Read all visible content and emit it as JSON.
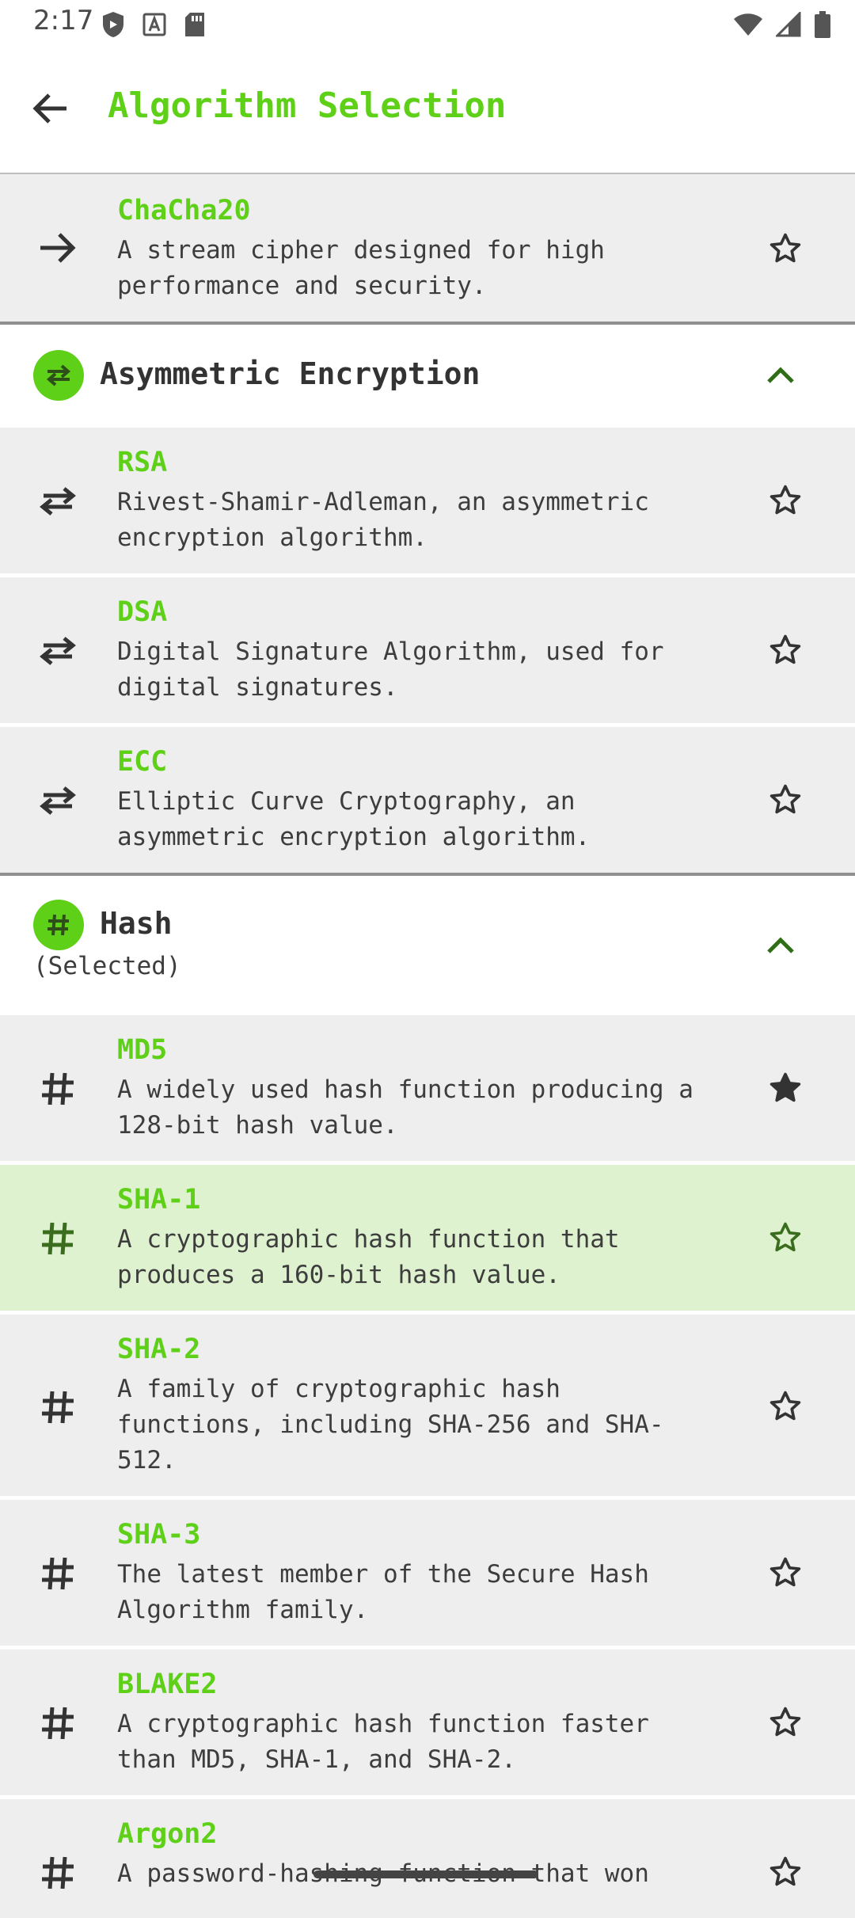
{
  "status_bar": {
    "time": "2:17"
  },
  "app_bar": {
    "title": "Algorithm Selection"
  },
  "colors": {
    "accent": "#5fd018",
    "selected_row": "#dff2cf",
    "row_bg": "#eeeeee"
  },
  "symmetric_tail": {
    "items": [
      {
        "title": "ChaCha20",
        "desc": "A stream cipher designed for high performance and security.",
        "icon": "arrow-right-icon",
        "favorite": false
      }
    ]
  },
  "asymmetric": {
    "title": "Asymmetric Encryption",
    "icon": "swap-icon",
    "items": [
      {
        "title": "RSA",
        "desc": "Rivest-Shamir-Adleman, an asymmetric encryption algorithm.",
        "icon": "swap-icon",
        "favorite": false
      },
      {
        "title": "DSA",
        "desc": "Digital Signature Algorithm, used for digital signatures.",
        "icon": "swap-icon",
        "favorite": false
      },
      {
        "title": "ECC",
        "desc": "Elliptic Curve Cryptography, an asymmetric encryption algorithm.",
        "icon": "swap-icon",
        "favorite": false
      }
    ]
  },
  "hash": {
    "title": "Hash",
    "subtitle": "(Selected)",
    "icon": "hash-icon",
    "items": [
      {
        "title": "MD5",
        "desc": "A widely used hash function producing a 128-bit hash value.",
        "icon": "hash-icon",
        "favorite": true
      },
      {
        "title": "SHA-1",
        "desc": "A cryptographic hash function that produces a 160-bit hash value.",
        "icon": "hash-icon",
        "favorite": false,
        "selected": true
      },
      {
        "title": "SHA-2",
        "desc": "A family of cryptographic hash functions, including SHA-256 and SHA-512.",
        "icon": "hash-icon",
        "favorite": false
      },
      {
        "title": "SHA-3",
        "desc": "The latest member of the Secure Hash Algorithm family.",
        "icon": "hash-icon",
        "favorite": false
      },
      {
        "title": "BLAKE2",
        "desc": "A cryptographic hash function faster than MD5, SHA-1, and SHA-2.",
        "icon": "hash-icon",
        "favorite": false
      },
      {
        "title": "Argon2",
        "desc": "A password-hashing function that won",
        "icon": "hash-icon",
        "favorite": false
      }
    ]
  }
}
